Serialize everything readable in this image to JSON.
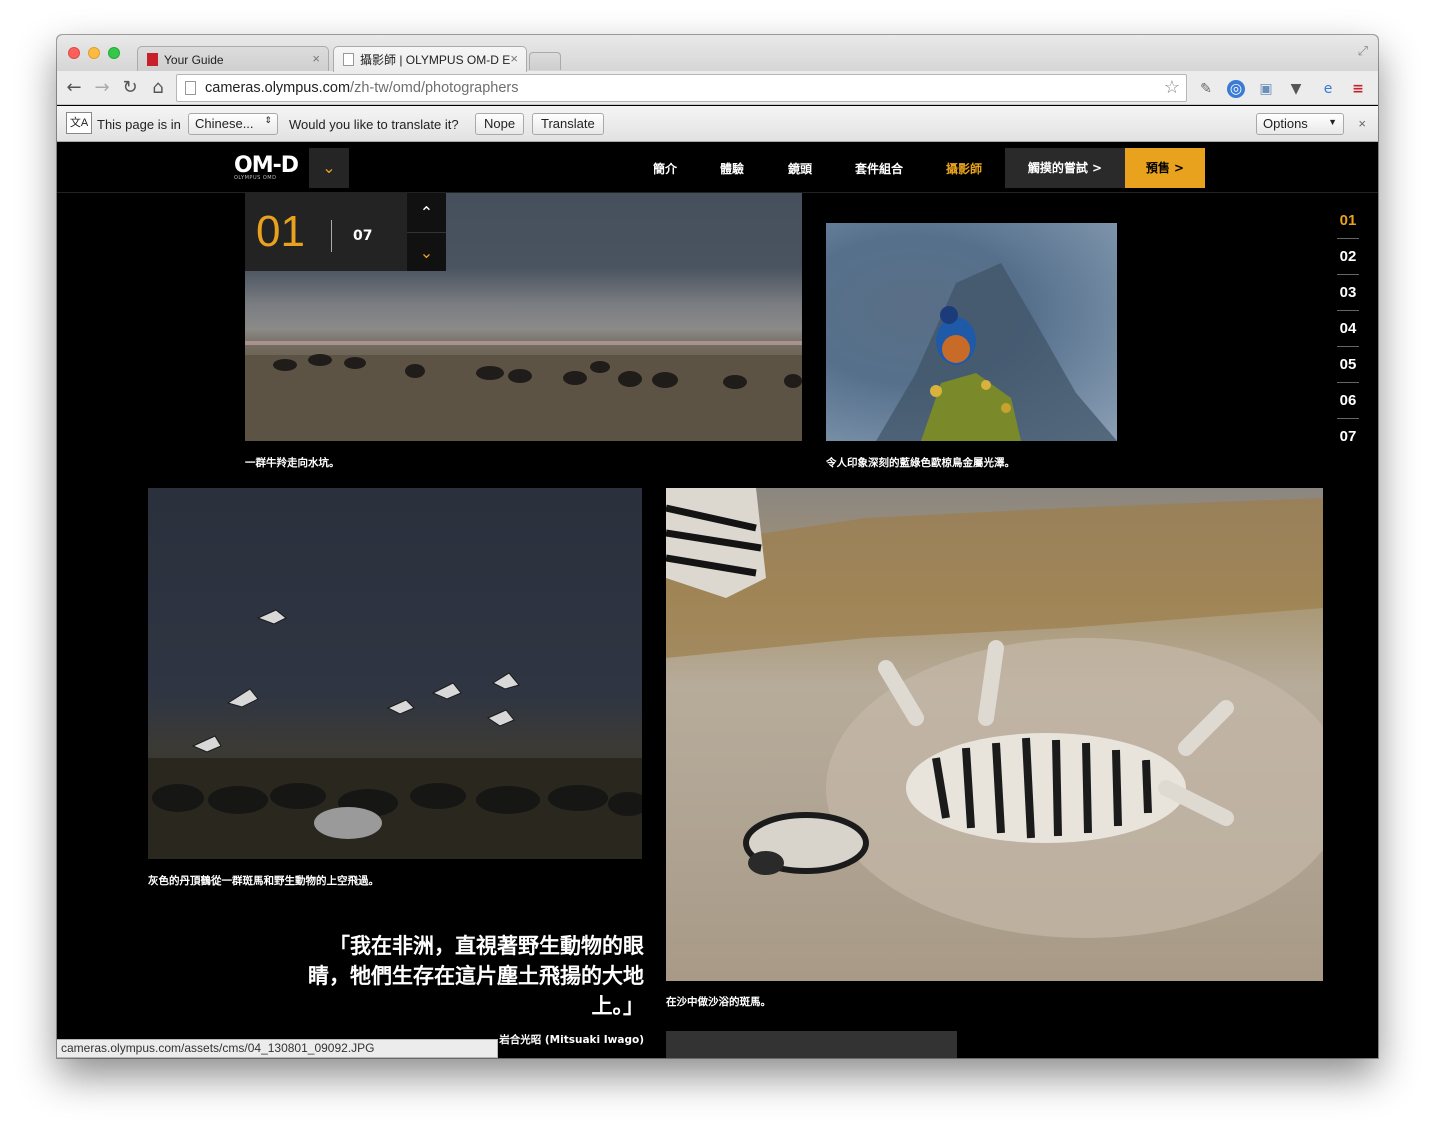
{
  "browser": {
    "tabs": [
      {
        "title": "Your Guide"
      },
      {
        "title": "攝影師 | OLYMPUS OM-D E"
      }
    ],
    "url_host": "cameras.olympus.com",
    "url_path": "/zh-tw/omd/photographers",
    "status_url": "cameras.olympus.com/assets/cms/04_130801_09092.JPG"
  },
  "translate_bar": {
    "page_is_in": "This page is in",
    "language": "Chinese...",
    "question": "Would you like to translate it?",
    "nope": "Nope",
    "translate": "Translate",
    "options": "Options"
  },
  "site": {
    "logo": "OM-D",
    "logo_sub": "OLYMPUS OMD",
    "nav": [
      "簡介",
      "體驗",
      "鏡頭",
      "套件組合",
      "攝影師"
    ],
    "try_label": "觸摸的嘗試 >",
    "preorder_label": "預售 >"
  },
  "slider": {
    "current": "01",
    "total": "07",
    "indicators": [
      "01",
      "02",
      "03",
      "04",
      "05",
      "06",
      "07"
    ]
  },
  "photos": [
    {
      "caption": "一群牛羚走向水坑。"
    },
    {
      "caption": "令人印象深刻的藍綠色歐椋鳥金屬光澤。"
    },
    {
      "caption": "灰色的丹頂鶴從一群斑馬和野生動物的上空飛過。"
    },
    {
      "caption": "在沙中做沙浴的斑馬。"
    }
  ],
  "quote": {
    "text": "「我在非洲，直視著野生動物的眼睛，牠們生存在這片塵土飛揚的大地上。」",
    "author": "岩合光昭 (Mitsuaki Iwago)"
  },
  "colors": {
    "accent": "#e8a21d",
    "background": "#000000"
  }
}
